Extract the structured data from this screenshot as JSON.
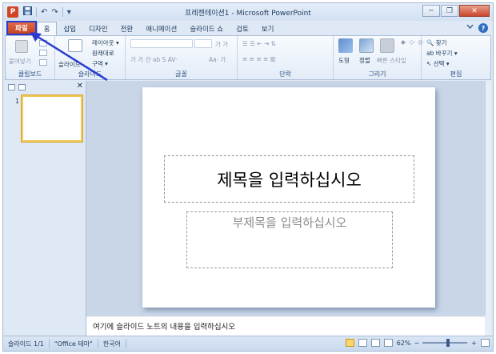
{
  "window": {
    "title": "프레젠테이션1 - Microsoft PowerPoint",
    "app_icon_letter": "P",
    "qat_undo": "↶",
    "qat_redo": "↷",
    "qat_customize": "▾",
    "minimize": "─",
    "restore": "❐",
    "close": "✕"
  },
  "tabs": [
    {
      "label": "파일"
    },
    {
      "label": "홈"
    },
    {
      "label": "삽입"
    },
    {
      "label": "디자인"
    },
    {
      "label": "전환"
    },
    {
      "label": "애니메이션"
    },
    {
      "label": "슬라이드 쇼"
    },
    {
      "label": "검토"
    },
    {
      "label": "보기"
    }
  ],
  "ribbon": {
    "clipboard": {
      "label": "클립보드",
      "paste": "붙여넣기"
    },
    "slides": {
      "label": "슬라이드",
      "new_slide": "슬라이드",
      "layout": "레이아웃 ▾",
      "reset": "원래대로",
      "section": "구역 ▾"
    },
    "font": {
      "label": "글꼴"
    },
    "paragraph": {
      "label": "단락"
    },
    "drawing": {
      "label": "그리기",
      "shapes": "도형",
      "arrange": "정렬",
      "quick_styles": "빠른 스타일"
    },
    "editing": {
      "label": "편집",
      "find": "찾기",
      "replace": "바꾸기 ▾",
      "select": "선택 ▾"
    }
  },
  "slide_panel": {
    "thumb_number": "1",
    "close": "✕"
  },
  "slide": {
    "title_placeholder": "제목을 입력하십시오",
    "subtitle_placeholder": "부제목을 입력하십시오"
  },
  "notes": {
    "placeholder": "여기에 슬라이드 노트의 내용을 입력하십시오"
  },
  "status": {
    "slide_count": "슬라이드 1/1",
    "theme": "\"Office 테마\"",
    "language": "한국어",
    "zoom": "62%",
    "zoom_out": "─",
    "zoom_in": "+",
    "zoom_level": 0.62
  },
  "colors": {
    "file_tab": "#c5431f",
    "annotation": "#2a3bd0"
  }
}
